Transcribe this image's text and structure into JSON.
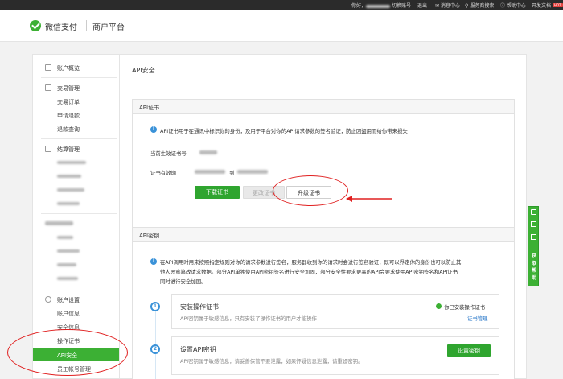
{
  "topbar": {
    "greeting": "你好，",
    "switch_account": "切换账号",
    "logout": "退出",
    "messages": "消息中心",
    "service_search": "服务商搜索",
    "help": "帮助中心",
    "dev_docs": "开发文档",
    "hot_badge": "HOT"
  },
  "header": {
    "brand": "微信支付",
    "platform": "商户平台"
  },
  "sidebar": {
    "overview": "账户概览",
    "trade_mgmt": "交易管理",
    "trade_orders": "交易订单",
    "apply_refund": "申请退款",
    "refund_query": "退款查询",
    "settle_mgmt": "结算管理",
    "account_settings": "账户设置",
    "account_info": "账户信息",
    "security_info": "安全信息",
    "op_cert": "操作证书",
    "api_security": "API安全",
    "staff_mgmt": "员工帐号管理"
  },
  "main": {
    "title": "API安全",
    "cert_card": {
      "title": "API证书",
      "tip": "API证书用于在通讯中标识你的身份，及用于平台对你的API请求参数的签名验证，防止因盗用而给你带来损失",
      "current_cert_label": "当前生效证书号",
      "validity_label": "证书有效期",
      "validity_to": "到",
      "btn_download": "下载证书",
      "btn_change": "更改证书",
      "btn_upgrade": "升级证书"
    },
    "key_card": {
      "title": "API密钥",
      "tip_line1": "在API调用时用来按照指定规则对你的请求参数进行签名，服务器收到你的请求时会进行签名验证，既可以界定你的身份也可以防止其",
      "tip_line2": "他人恶意篡改请求数据。部分API单独使用API密钥签名进行安全加固，部分安全性要求更高的API会要求使用API密钥签名和API证书",
      "tip_line3": "同时进行安全加固。",
      "step1_num": "1",
      "step1_title": "安装操作证书",
      "step1_desc": "API密钥属于敏感信息，只有安装了操作证书的用户才能操作",
      "step1_status": "你已安装操作证书",
      "step1_link": "证书管理",
      "step2_num": "2",
      "step2_title": "设置API密钥",
      "step2_desc": "API密钥属于敏感信息，请妥善保管不要泄露，如果怀疑信息泄露，请重设密钥。",
      "step2_btn": "设置密钥"
    }
  },
  "float_bar": {
    "label": "获取帮助"
  },
  "colors": {
    "accent": "#3cb034",
    "annotation": "#e02020",
    "info": "#3a92d8"
  }
}
